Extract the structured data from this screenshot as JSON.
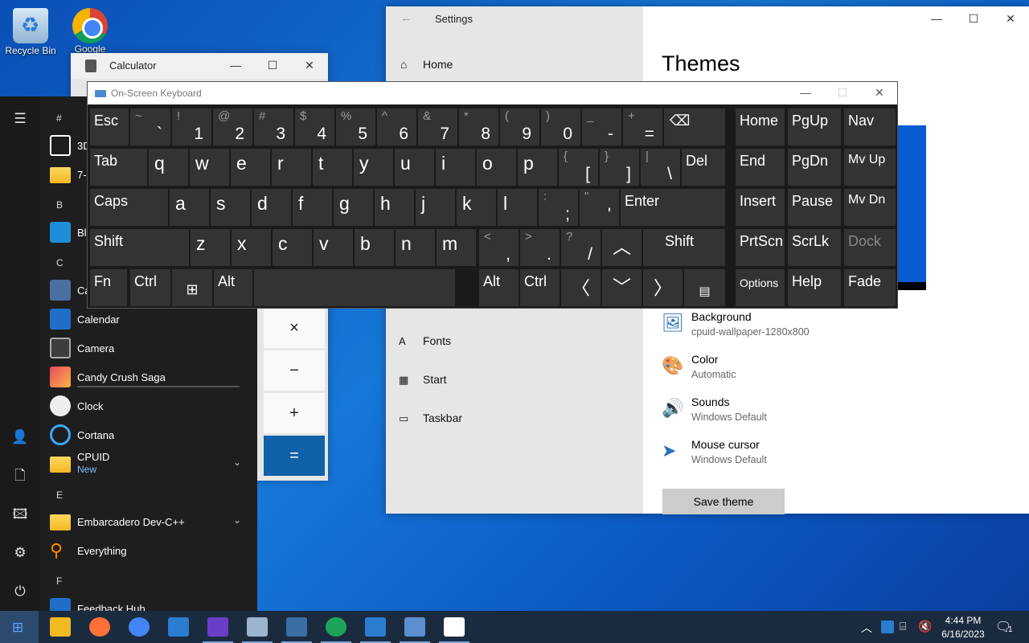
{
  "desktop": {
    "icons": [
      {
        "label": "Recycle Bin",
        "icon": "recycle-bin-icon"
      },
      {
        "label": "Google",
        "icon": "chrome-icon"
      }
    ]
  },
  "settings": {
    "title": "Settings",
    "back_glyph": "←",
    "controls": {
      "minimize": "—",
      "maximize": "☐",
      "close": "✕"
    },
    "home_label": "Home",
    "heading": "Themes",
    "nav": [
      {
        "label": "Fonts",
        "icon": "fonts-icon",
        "glyph": "A"
      },
      {
        "label": "Start",
        "icon": "start-icon",
        "glyph": "▦"
      },
      {
        "label": "Taskbar",
        "icon": "taskbar-icon",
        "glyph": "▭"
      }
    ],
    "theme_items": [
      {
        "name": "Background",
        "value": "cpuid-wallpaper-1280x800",
        "icon": "picture-icon",
        "glyph": "🖼"
      },
      {
        "name": "Color",
        "value": "Automatic",
        "icon": "palette-icon",
        "glyph": "🎨"
      },
      {
        "name": "Sounds",
        "value": "Windows Default",
        "icon": "speaker-icon",
        "glyph": "🔊"
      },
      {
        "name": "Mouse cursor",
        "value": "Windows Default",
        "icon": "cursor-icon",
        "glyph": "➤"
      }
    ],
    "save_theme": "Save theme",
    "preview_color": "#0a5ad0"
  },
  "calculator": {
    "title": "Calculator",
    "controls": {
      "minimize": "—",
      "maximize": "☐",
      "close": "✕"
    },
    "ops": [
      "×",
      "−",
      "+",
      "="
    ],
    "accent": "#0f61a8"
  },
  "start_menu": {
    "rail": [
      {
        "icon": "hamburger-icon",
        "glyph": "☰"
      },
      {
        "icon": "user-icon",
        "glyph": "👤"
      },
      {
        "icon": "documents-icon",
        "glyph": "🗋"
      },
      {
        "icon": "pictures-icon",
        "glyph": "🖾"
      },
      {
        "icon": "settings-icon",
        "glyph": "⚙"
      },
      {
        "icon": "power-icon",
        "glyph": "⏻"
      }
    ],
    "letters": {
      "hash": "#",
      "b": "B",
      "c": "C",
      "e": "E",
      "f": "F"
    },
    "apps": {
      "obj3d": "3D",
      "zip": "7-",
      "blend": "Bl",
      "calc": "Ca",
      "calendar": "Calendar",
      "camera": "Camera",
      "candy": "Candy Crush Saga",
      "clock": "Clock",
      "cortana": "Cortana",
      "cpuid": "CPUID",
      "cpuid_sub": "New",
      "embarcadero": "Embarcadero Dev-C++",
      "everything": "Everything",
      "feedback": "Feedback Hub"
    },
    "chevron": "⌄"
  },
  "osk": {
    "title": "On-Screen Keyboard",
    "controls": {
      "minimize": "—",
      "maximize": "☐",
      "close": "✕"
    },
    "row1": {
      "esc": "Esc",
      "grave": {
        "shift": "~",
        "main": "`"
      },
      "n1": {
        "shift": "!",
        "main": "1"
      },
      "n2": {
        "shift": "@",
        "main": "2"
      },
      "n3": {
        "shift": "#",
        "main": "3"
      },
      "n4": {
        "shift": "$",
        "main": "4"
      },
      "n5": {
        "shift": "%",
        "main": "5"
      },
      "n6": {
        "shift": "^",
        "main": "6"
      },
      "n7": {
        "shift": "&",
        "main": "7"
      },
      "n8": {
        "shift": "*",
        "main": "8"
      },
      "n9": {
        "shift": "(",
        "main": "9"
      },
      "n0": {
        "shift": ")",
        "main": "0"
      },
      "minus": {
        "shift": "_",
        "main": "-"
      },
      "equals": {
        "shift": "+",
        "main": "="
      },
      "backspace": "⌫",
      "home": "Home",
      "pgup": "PgUp",
      "nav": "Nav"
    },
    "row2": {
      "tab": "Tab",
      "letters": [
        "q",
        "w",
        "e",
        "r",
        "t",
        "y",
        "u",
        "i",
        "o",
        "p"
      ],
      "lbracket": {
        "shift": "{",
        "main": "["
      },
      "rbracket": {
        "shift": "}",
        "main": "]"
      },
      "backslash": {
        "shift": "|",
        "main": "\\"
      },
      "del": "Del",
      "end": "End",
      "pgdn": "PgDn",
      "mvup": "Mv Up"
    },
    "row3": {
      "caps": "Caps",
      "letters": [
        "a",
        "s",
        "d",
        "f",
        "g",
        "h",
        "j",
        "k",
        "l"
      ],
      "semicolon": {
        "shift": ":",
        "main": ";"
      },
      "quote": {
        "shift": "\"",
        "main": "'"
      },
      "enter": "Enter",
      "insert": "Insert",
      "pause": "Pause",
      "mvdn": "Mv Dn"
    },
    "row4": {
      "shift_l": "Shift",
      "letters": [
        "z",
        "x",
        "c",
        "v",
        "b",
        "n",
        "m"
      ],
      "comma": {
        "shift": "<",
        "main": ","
      },
      "period": {
        "shift": ">",
        "main": "."
      },
      "slash": {
        "shift": "?",
        "main": "/"
      },
      "up": "︿",
      "shift_r": "Shift",
      "prtscn": "PrtScn",
      "scrlk": "ScrLk",
      "dock": "Dock"
    },
    "row5": {
      "fn": "Fn",
      "ctrl_l": "Ctrl",
      "win": "⊞",
      "alt_l": "Alt",
      "alt_r": "Alt",
      "ctrl_r": "Ctrl",
      "left": "〈",
      "down": "﹀",
      "right": "〉",
      "menu": "▤",
      "options": "Options",
      "help": "Help",
      "fade": "Fade"
    }
  },
  "taskbar": {
    "apps": [
      {
        "icon": "file-explorer-icon",
        "color": "#f2b922"
      },
      {
        "icon": "firefox-icon",
        "color": "#ff7139"
      },
      {
        "icon": "chrome-icon",
        "color": "#4285f4"
      },
      {
        "icon": "store-icon",
        "color": "#2a7dd1"
      },
      {
        "icon": "cpu-z-icon",
        "color": "#6a3ec9"
      },
      {
        "icon": "network-icon",
        "color": "#9cb4cc"
      },
      {
        "icon": "calculator-icon",
        "color": "#3a6ea5"
      },
      {
        "icon": "edge-icon",
        "color": "#1ea45a"
      },
      {
        "icon": "calendar-icon",
        "color": "#2a7dd1"
      },
      {
        "icon": "on-screen-keyboard-icon",
        "color": "#5b8fd0"
      },
      {
        "icon": "settings-icon",
        "color": "#ffffff"
      }
    ],
    "time": "4:44 PM",
    "date": "6/16/2023",
    "notification_count": "1",
    "tray_chevron": "︿"
  }
}
